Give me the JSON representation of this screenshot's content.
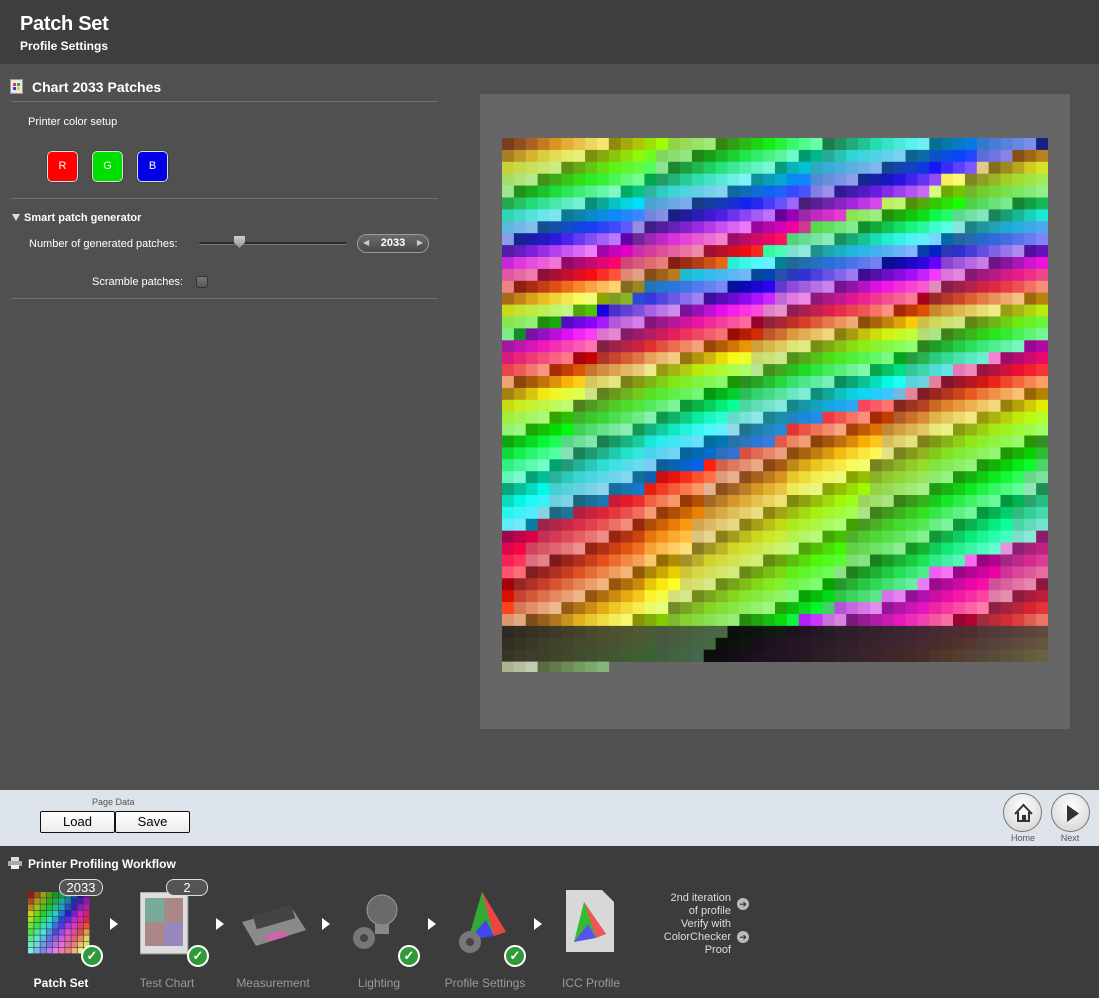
{
  "header": {
    "title": "Patch Set",
    "subtitle": "Profile Settings"
  },
  "chart": {
    "title": "Chart 2033 Patches",
    "printer_color_setup_label": "Printer color setup",
    "channels": [
      {
        "label": "R",
        "color": "#ff0000"
      },
      {
        "label": "G",
        "color": "#00e000"
      },
      {
        "label": "B",
        "color": "#0000e8"
      }
    ]
  },
  "generator": {
    "title": "Smart patch generator",
    "num_patches_label": "Number of generated patches:",
    "num_patches_value": "2033",
    "slider_level": 0.27,
    "scramble_label": "Scramble patches:",
    "scramble_checked": false
  },
  "page_data_bar": {
    "label": "Page Data",
    "load_label": "Load",
    "save_label": "Save",
    "home_label": "Home",
    "next_label": "Next"
  },
  "workflow": {
    "title": "Printer Profiling Workflow",
    "steps": [
      {
        "label": "Patch Set",
        "active": true,
        "badge": "2033",
        "done": true
      },
      {
        "label": "Test Chart",
        "active": false,
        "badge": "2",
        "done": true
      },
      {
        "label": "Measurement",
        "active": false,
        "done": false
      },
      {
        "label": "Lighting",
        "active": false,
        "done": true
      },
      {
        "label": "Profile Settings",
        "active": false,
        "done": true
      },
      {
        "label": "ICC Profile",
        "active": false,
        "done": false
      }
    ],
    "iteration_text": [
      "2nd iteration",
      "of profile"
    ],
    "verify_text": [
      "Verify with",
      "ColorChecker",
      "Proof"
    ]
  }
}
